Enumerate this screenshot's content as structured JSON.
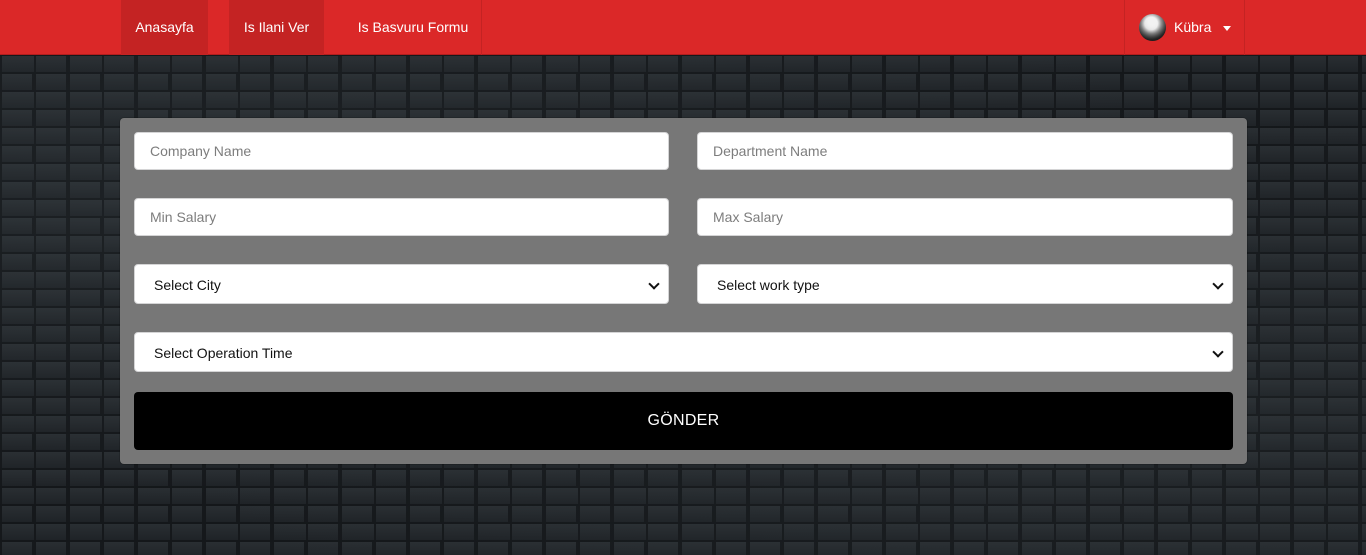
{
  "navbar": {
    "items": [
      {
        "label": "Anasayfa",
        "active": true
      },
      {
        "label": "Is Ilani Ver",
        "active": true
      },
      {
        "label": "Is Basvuru Formu",
        "active": false
      }
    ],
    "user": {
      "name": "Kübra"
    },
    "colors": {
      "bar": "#db2828",
      "active": "#c42323"
    }
  },
  "form": {
    "company_name_placeholder": "Company Name",
    "department_name_placeholder": "Department Name",
    "min_salary_placeholder": "Min Salary",
    "max_salary_placeholder": "Max Salary",
    "city_select": "Select City",
    "work_type_select": "Select work type",
    "operation_time_select": "Select Operation Time",
    "submit_label": "GÖNDER",
    "colors": {
      "panel": "#777777",
      "submit": "#000000"
    }
  }
}
